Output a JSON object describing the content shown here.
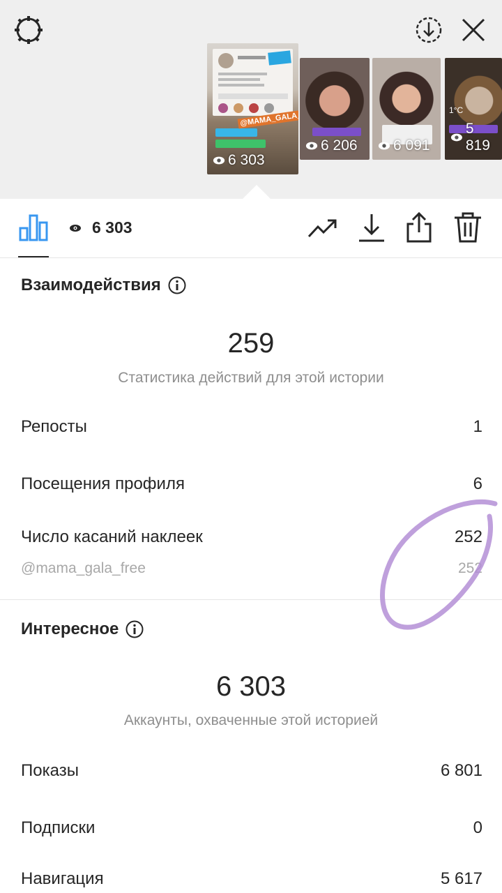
{
  "top": {
    "thumbnails": [
      {
        "views": "6 303",
        "selected": true
      },
      {
        "views": "6 206"
      },
      {
        "views": "6 091"
      },
      {
        "views": "5 819"
      }
    ],
    "thumb_sticker_text": "@MAMA_GALA_FREE",
    "thumb_weather_text": "1°C"
  },
  "toolbar": {
    "views": "6 303",
    "icons": [
      "bar-chart-icon",
      "eye-icon",
      "trend-icon",
      "download-icon",
      "share-icon",
      "trash-icon"
    ]
  },
  "interactions": {
    "title": "Взаимодействия",
    "total": "259",
    "subtitle": "Статистика действий для этой истории",
    "rows": [
      {
        "label": "Репосты",
        "value": "1"
      },
      {
        "label": "Посещения профиля",
        "value": "6"
      },
      {
        "label": "Число касаний наклеек",
        "value": "252"
      }
    ],
    "sticker": {
      "label": "@mama_gala_free",
      "value": "252"
    }
  },
  "discovery": {
    "title": "Интересное",
    "total": "6 303",
    "subtitle": "Аккаунты, охваченные этой историей",
    "rows": [
      {
        "label": "Показы",
        "value": "6 801"
      },
      {
        "label": "Подписки",
        "value": "0"
      },
      {
        "label": "Навигация",
        "value": "5 617"
      }
    ]
  },
  "colors": {
    "accent": "#3897f0",
    "scribble": "#b48fd6",
    "text": "#262626",
    "muted": "#8e8e8e"
  }
}
